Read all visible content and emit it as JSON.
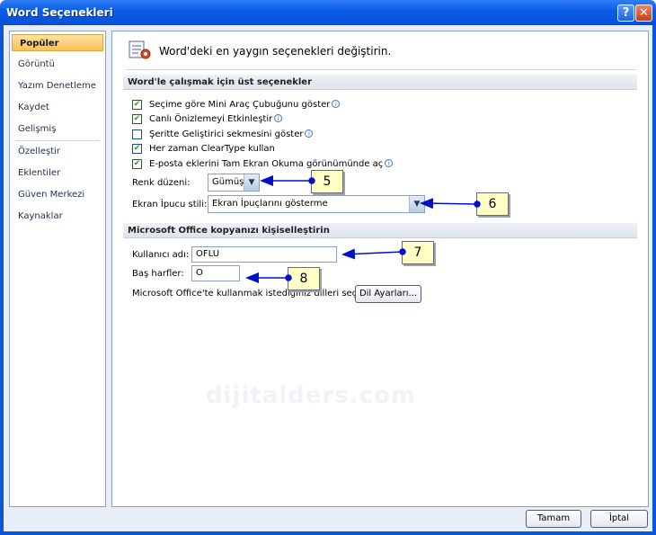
{
  "window": {
    "title": "Word Seçenekleri",
    "help_label": "?",
    "close_label": "✕"
  },
  "sidebar": {
    "items": [
      {
        "label": "Popüler"
      },
      {
        "label": "Görüntü"
      },
      {
        "label": "Yazım Denetleme"
      },
      {
        "label": "Kaydet"
      },
      {
        "label": "Gelişmiş"
      },
      {
        "label": "Özelleştir"
      },
      {
        "label": "Eklentiler"
      },
      {
        "label": "Güven Merkezi"
      },
      {
        "label": "Kaynaklar"
      }
    ]
  },
  "header": {
    "text": "Word'deki en yaygın seçenekleri değiştirin.",
    "icon": "options-settings-icon"
  },
  "section1": {
    "title": "Word'le çalışmak için üst seçenekler",
    "checkboxes": [
      {
        "label": "Seçime göre Mini Araç Çubuğunu göster",
        "checked": true,
        "info": true
      },
      {
        "label": "Canlı Önizlemeyi Etkinleştir",
        "checked": true,
        "info": true
      },
      {
        "label": "Şeritte Geliştirici sekmesini göster",
        "checked": false,
        "info": true
      },
      {
        "label": "Her zaman ClearType kullan",
        "checked": true,
        "info": false
      },
      {
        "label": "E-posta eklerini Tam Ekran Okuma görünümünde aç",
        "checked": true,
        "info": true
      }
    ],
    "color_scheme_label": "Renk düzeni:",
    "color_scheme_value": "Gümüş",
    "tooltip_label": "Ekran İpucu stili:",
    "tooltip_value": "Ekran İpuçlarını gösterme"
  },
  "section2": {
    "title": "Microsoft Office kopyanızı kişiselleştirin",
    "username_label": "Kullanıcı adı:",
    "username_value": "OFLU",
    "initials_label": "Baş harfler:",
    "initials_value": "O",
    "language_text": "Microsoft Office'te kullanmak istediğiniz dilleri seçin:",
    "language_button": "Dil Ayarları..."
  },
  "footer": {
    "ok_label": "Tamam",
    "cancel_label": "İptal"
  },
  "callouts": [
    "5",
    "6",
    "7",
    "8"
  ],
  "watermark": "dijitalders.com",
  "colors": {
    "titlebar": "#0b5ee8",
    "active_item": "#f9c15a",
    "callout_bg": "#ffffc6",
    "arrow": "#0010c8"
  }
}
